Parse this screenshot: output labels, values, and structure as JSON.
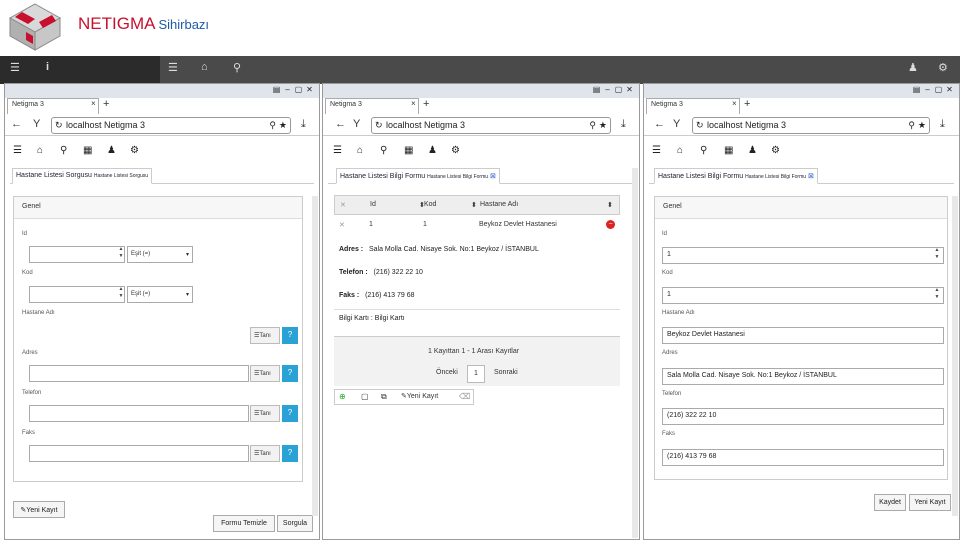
{
  "header": {
    "brand": "NETIGMA",
    "subtitle": "Sihirbazı",
    "accent_red": "#c8102e",
    "accent_blue": "#1e5aa8"
  },
  "topbar": {
    "icons": [
      "menu-icon",
      "info-icon",
      "list-icon",
      "home-icon",
      "map-pin-icon",
      "user-icon",
      "gear-icon"
    ]
  },
  "browser": {
    "tab_title": "Netigma 3",
    "address": "localhost Netigma 3",
    "back": "←",
    "forward": "→",
    "reload": "↻",
    "home_y": "Y",
    "new_tab": "+",
    "close": "×",
    "download": "⤓",
    "search": "⚲",
    "star": "★"
  },
  "window1": {
    "tab_label": "Hastane Listesi Sorgusu",
    "tab_small": "Hastane Listesi Sorgusu",
    "panel_title": "Genel",
    "fields": [
      {
        "label": "Id",
        "operator": "Eşit (=)"
      },
      {
        "label": "Kod",
        "operator": "Eşit (=)"
      },
      {
        "label": "Hastane Adı",
        "button": "Tanı",
        "q": "?"
      },
      {
        "label": "Adres",
        "button": "Tanı",
        "q": "?"
      },
      {
        "label": "Telefon",
        "button": "Tanı",
        "q": "?"
      },
      {
        "label": "Faks",
        "button": "Tanı",
        "q": "?"
      }
    ],
    "new_record": "Yeni Kayıt",
    "clear_form": "Formu Temizle",
    "query": "Sorgula"
  },
  "window2": {
    "tab_label": "Hastane Listesi Bilgi Formu",
    "tab_small": "Hastane Listesi Bilgi Formu",
    "columns": [
      "Id",
      "Kod",
      "Hastane Adı"
    ],
    "row": {
      "id": "1",
      "kod": "1",
      "name": "Beykoz Devlet Hastanesi"
    },
    "details": [
      {
        "label": "Adres :",
        "value": "Sala Molla Cad. Nisaye Sok. No:1 Beykoz / İSTANBUL"
      },
      {
        "label": "Telefon :",
        "value": "(216) 322 22 10"
      },
      {
        "label": "Faks :",
        "value": "(216) 413 79 68"
      }
    ],
    "info_card": "Bilgi Kartı : Bilgi Kartı",
    "paging_info": "1 Kayıttan 1 - 1 Arası Kayıtlar",
    "prev": "Önceki",
    "page": "1",
    "next": "Sonraki",
    "new_record": "Yeni Kayıt"
  },
  "window3": {
    "tab_label": "Hastane Listesi Bilgi Formu",
    "tab_small": "Hastane Listesi Bilgi Formu",
    "panel_title": "Genel",
    "fields": [
      {
        "label": "Id",
        "value": "1"
      },
      {
        "label": "Kod",
        "value": "1"
      },
      {
        "label": "Hastane Adı",
        "value": "Beykoz Devlet Hastanesi"
      },
      {
        "label": "Adres",
        "value": "Sala Molla Cad. Nisaye Sok. No:1 Beykoz / İSTANBUL"
      },
      {
        "label": "Telefon",
        "value": "(216) 322 22 10"
      },
      {
        "label": "Faks",
        "value": "(216) 413 79 68"
      }
    ],
    "save": "Kaydet",
    "new_record": "Yeni Kayıt"
  }
}
